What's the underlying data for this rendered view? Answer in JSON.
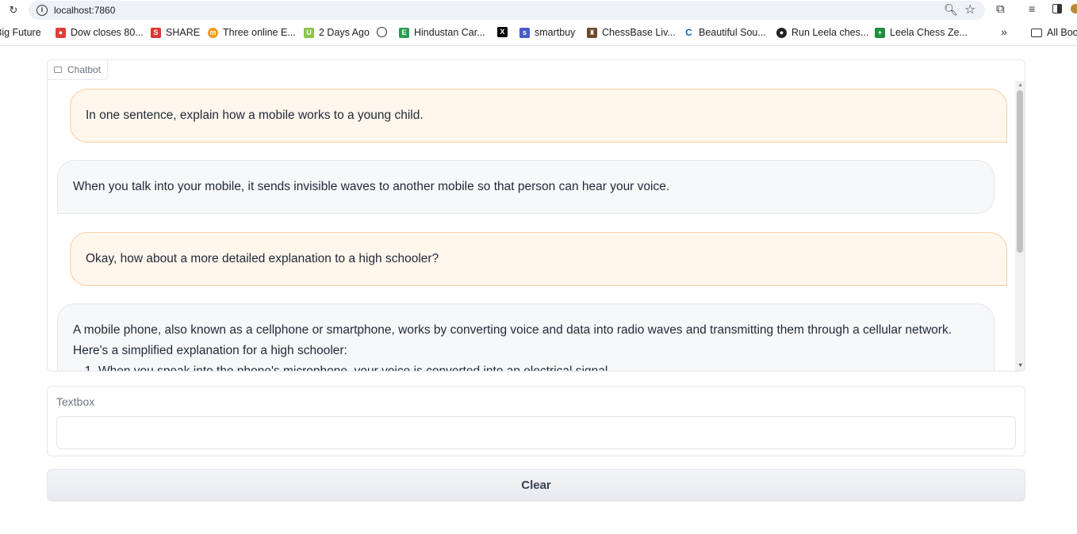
{
  "browser": {
    "url": "localhost:7860",
    "bookmarks": [
      {
        "label": "Big Future",
        "icon": "none",
        "color": "#ffffff"
      },
      {
        "label": "Dow closes 80...",
        "icon": "nbc-peacock-icon",
        "color": "#e23b3b"
      },
      {
        "label": "SHARE",
        "icon": "share-icon",
        "color": "#d9382f"
      },
      {
        "label": "Three online E...",
        "icon": "orange-circle-icon",
        "color": "#f39a1e"
      },
      {
        "label": "2 Days Ago",
        "icon": "green-square-icon",
        "color": "#8bc34a"
      },
      {
        "label": "",
        "icon": "globe-icon",
        "color": "#333333"
      },
      {
        "label": "Hindustan Car...",
        "icon": "hindustan-icon",
        "color": "#2e9d4f"
      },
      {
        "label": "",
        "icon": "x-icon",
        "color": "#000000"
      },
      {
        "label": "smartbuy",
        "icon": "smartbuy-icon",
        "color": "#4a5cc7"
      },
      {
        "label": "ChessBase Liv...",
        "icon": "chessbase-icon",
        "color": "#6b4a2b"
      },
      {
        "label": "Beautiful Sou...",
        "icon": "c-icon",
        "color": "#1565c0"
      },
      {
        "label": "Run Leela ches...",
        "icon": "github-icon",
        "color": "#222222"
      },
      {
        "label": "Leela Chess Ze...",
        "icon": "sheets-icon",
        "color": "#1e8e3e"
      }
    ],
    "all_bookmarks_label": "All Boo",
    "more_bookmarks": "»"
  },
  "chatbot": {
    "label": "Chatbot",
    "messages": [
      {
        "role": "user",
        "text": "In one sentence, explain how a mobile works to a young child."
      },
      {
        "role": "bot",
        "text": "When you talk into your mobile, it sends invisible waves to another mobile so that person can hear your voice."
      },
      {
        "role": "user",
        "text": "Okay, how about a more detailed explanation to a high schooler?"
      },
      {
        "role": "bot",
        "text": "A mobile phone, also known as a cellphone or smartphone, works by converting voice and data into radio waves and transmitting them through a cellular network. Here's a simplified explanation for a high schooler:",
        "list_item": "When you speak into the phone's microphone, your voice is converted into an electrical signal."
      }
    ]
  },
  "textbox": {
    "label": "Textbox",
    "value": "",
    "placeholder": ""
  },
  "clear_button": {
    "label": "Clear"
  },
  "colors": {
    "user_bubble_bg": "#fff6ec",
    "user_bubble_border": "#f7cfa3",
    "bot_bubble_bg": "#f7f8fa"
  }
}
